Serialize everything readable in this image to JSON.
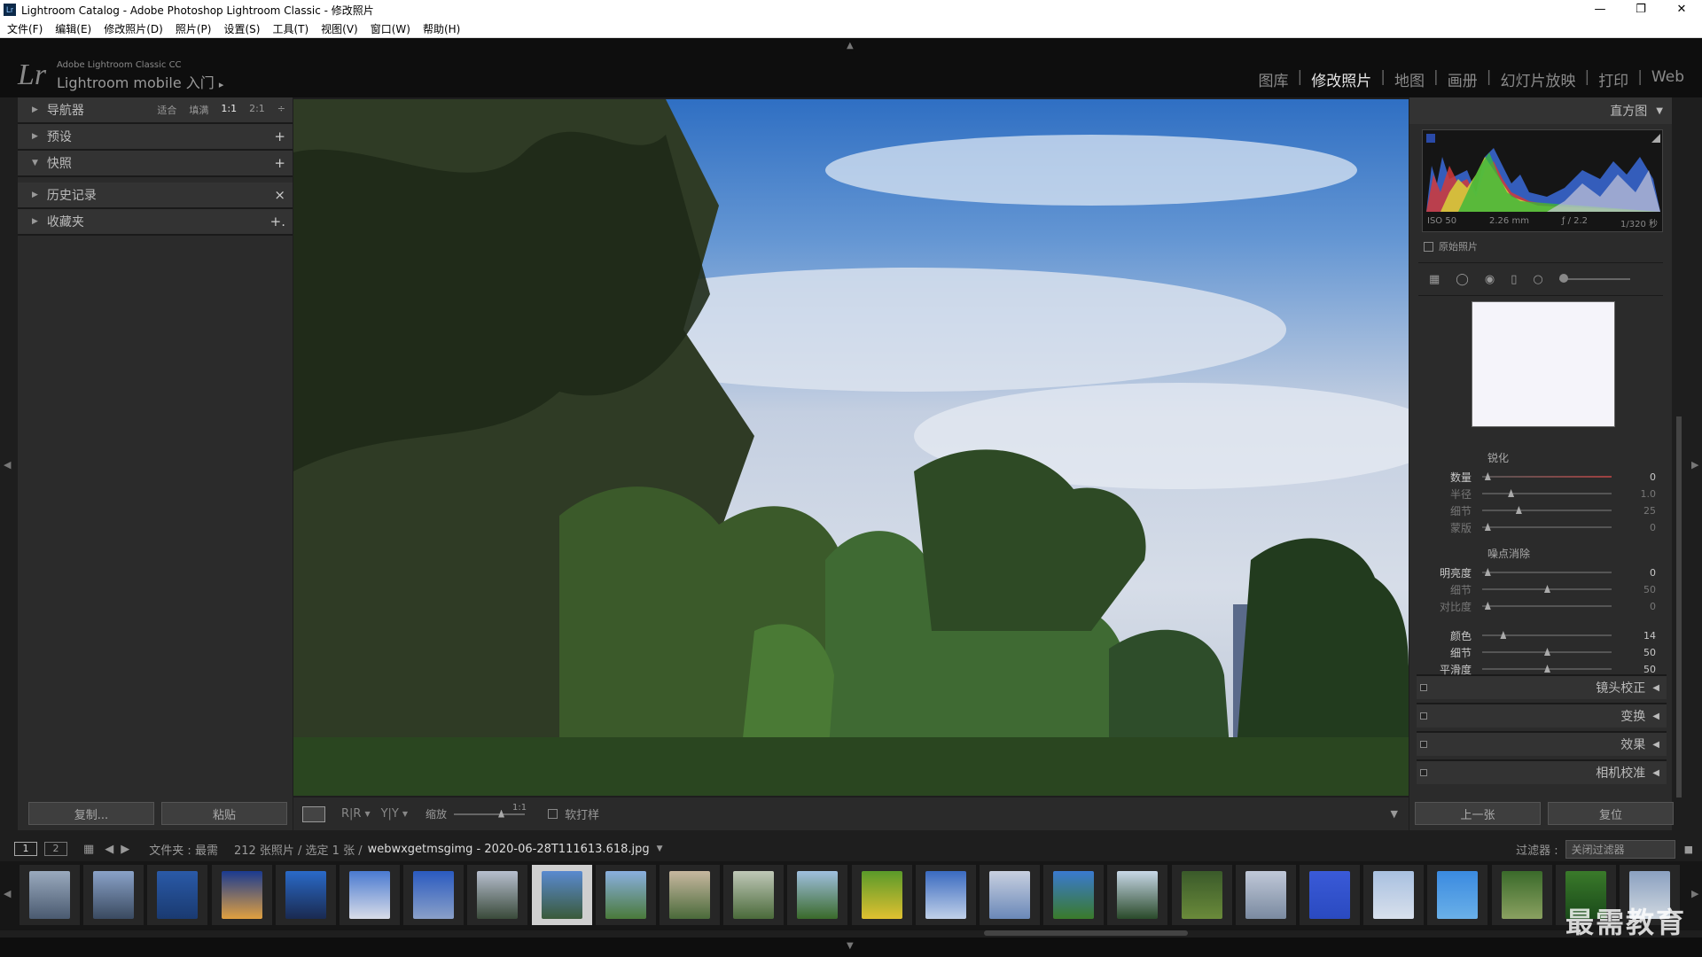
{
  "window": {
    "title": "Lightroom Catalog - Adobe Photoshop Lightroom Classic - 修改照片",
    "icon": "Lr"
  },
  "window_buttons": {
    "minimize": "—",
    "restore": "❐",
    "close": "✕"
  },
  "menu": [
    "文件(F)",
    "编辑(E)",
    "修改照片(D)",
    "照片(P)",
    "设置(S)",
    "工具(T)",
    "视图(V)",
    "窗口(W)",
    "帮助(H)"
  ],
  "identity": {
    "logo": "Lr",
    "product": "Adobe Lightroom Classic CC",
    "mobile": "Lightroom mobile 入门",
    "mobile_arrow": "▸"
  },
  "modules": [
    {
      "label": "图库",
      "active": false
    },
    {
      "label": "修改照片",
      "active": true
    },
    {
      "label": "地图",
      "active": false
    },
    {
      "label": "画册",
      "active": false
    },
    {
      "label": "幻灯片放映",
      "active": false
    },
    {
      "label": "打印",
      "active": false
    },
    {
      "label": "Web",
      "active": false
    }
  ],
  "left_panel": {
    "navigator": {
      "label": "导航器",
      "opts": [
        "适合",
        "填满",
        "1:1",
        "2:1"
      ],
      "spinner": "÷"
    },
    "presets": {
      "label": "预设",
      "action": "+"
    },
    "snapshots": {
      "label": "快照",
      "action": "+"
    },
    "history": {
      "label": "历史记录",
      "action": "×"
    },
    "collections": {
      "label": "收藏夹",
      "action": "+."
    },
    "copy_btn": "复制...",
    "paste_btn": "粘贴"
  },
  "toolbar": {
    "zoom_label": "缩放",
    "zoom_value": "1:1",
    "softproof_label": "软打样",
    "ab_label": "R|R",
    "yy_label": "Y|Y",
    "menu_arrow": "▼"
  },
  "right_panel": {
    "histogram_label": "直方图",
    "exif": {
      "iso": "ISO 50",
      "focal": "2.26 mm",
      "aperture": "ƒ / 2.2",
      "shutter": "1/320 秒"
    },
    "original_photo": "原始照片",
    "sharpening": {
      "title": "锐化",
      "rows": [
        {
          "label": "数量",
          "value": "0",
          "pos": 0.04
        },
        {
          "label": "半径",
          "value": "1.0",
          "pos": 0.22
        },
        {
          "label": "细节",
          "value": "25",
          "pos": 0.28
        },
        {
          "label": "蒙版",
          "value": "0",
          "pos": 0.04
        }
      ]
    },
    "noise": {
      "title": "噪点消除",
      "rows": [
        {
          "label": "明亮度",
          "value": "0",
          "pos": 0.04
        },
        {
          "label": "细节",
          "value": "50",
          "pos": 0.5
        },
        {
          "label": "对比度",
          "value": "0",
          "pos": 0.04
        },
        {
          "label": "颜色",
          "value": "14",
          "pos": 0.16
        },
        {
          "label": "细节",
          "value": "50",
          "pos": 0.5
        },
        {
          "label": "平滑度",
          "value": "50",
          "pos": 0.5
        }
      ]
    },
    "collapsed": [
      "镜头校正",
      "变换",
      "效果",
      "相机校准"
    ],
    "prev_btn": "上一张",
    "reset_btn": "复位"
  },
  "filmstrip_header": {
    "page1": "1",
    "page2": "2",
    "folder": "文件夹 : 最需",
    "count": "212 张照片 / 选定 1 张 /",
    "filename": "webwxgetmsgimg - 2020-06-28T111613.618.jpg",
    "filter_label": "过滤器 :",
    "filter_value": "关闭过滤器"
  },
  "colors": {
    "accent": "#e6e6e6",
    "panel": "#2b2b2b",
    "bg": "#1e1e1e"
  },
  "watermark": "最需教育"
}
